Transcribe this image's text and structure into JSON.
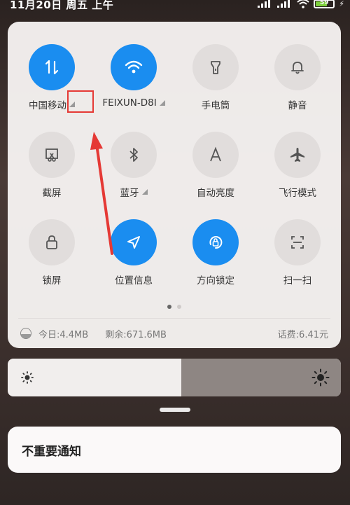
{
  "status_bar": {
    "time_text": "11月20日 周五 上午",
    "battery_level": "59",
    "icons": [
      "signal-1-icon",
      "signal-2-icon",
      "wifi-icon",
      "battery-icon",
      "charging-bolt-icon"
    ]
  },
  "quick_settings": {
    "tiles": [
      {
        "label": "中国移动",
        "icon": "mobile-data-icon",
        "state": "on",
        "has_more": true
      },
      {
        "label": "FEIXUN-D8I",
        "icon": "wifi-icon",
        "state": "on",
        "has_more": true
      },
      {
        "label": "手电筒",
        "icon": "flashlight-icon",
        "state": "off",
        "has_more": false
      },
      {
        "label": "静音",
        "icon": "bell-icon",
        "state": "off",
        "has_more": false
      },
      {
        "label": "截屏",
        "icon": "screenshot-icon",
        "state": "off",
        "has_more": false
      },
      {
        "label": "蓝牙",
        "icon": "bluetooth-icon",
        "state": "off",
        "has_more": true
      },
      {
        "label": "自动亮度",
        "icon": "auto-brightness-icon",
        "state": "off",
        "has_more": false
      },
      {
        "label": "飞行模式",
        "icon": "airplane-icon",
        "state": "off",
        "has_more": false
      },
      {
        "label": "锁屏",
        "icon": "lock-icon",
        "state": "off",
        "has_more": false
      },
      {
        "label": "位置信息",
        "icon": "location-icon",
        "state": "on",
        "has_more": false
      },
      {
        "label": "方向锁定",
        "icon": "rotation-lock-icon",
        "state": "on",
        "has_more": false
      },
      {
        "label": "扫一扫",
        "icon": "scan-icon",
        "state": "off",
        "has_more": false
      }
    ],
    "page_count": 2,
    "active_page": 1
  },
  "data_usage": {
    "today": "今日:4.4MB",
    "remaining": "剩余:671.6MB",
    "balance": "话费:6.41元"
  },
  "brightness": {
    "level_fraction": 0.52
  },
  "notifications": {
    "section_title": "不重要通知"
  },
  "colors": {
    "accent": "#1a8df0",
    "tile_off": "#e1dddc",
    "annotation": "#e53935"
  }
}
